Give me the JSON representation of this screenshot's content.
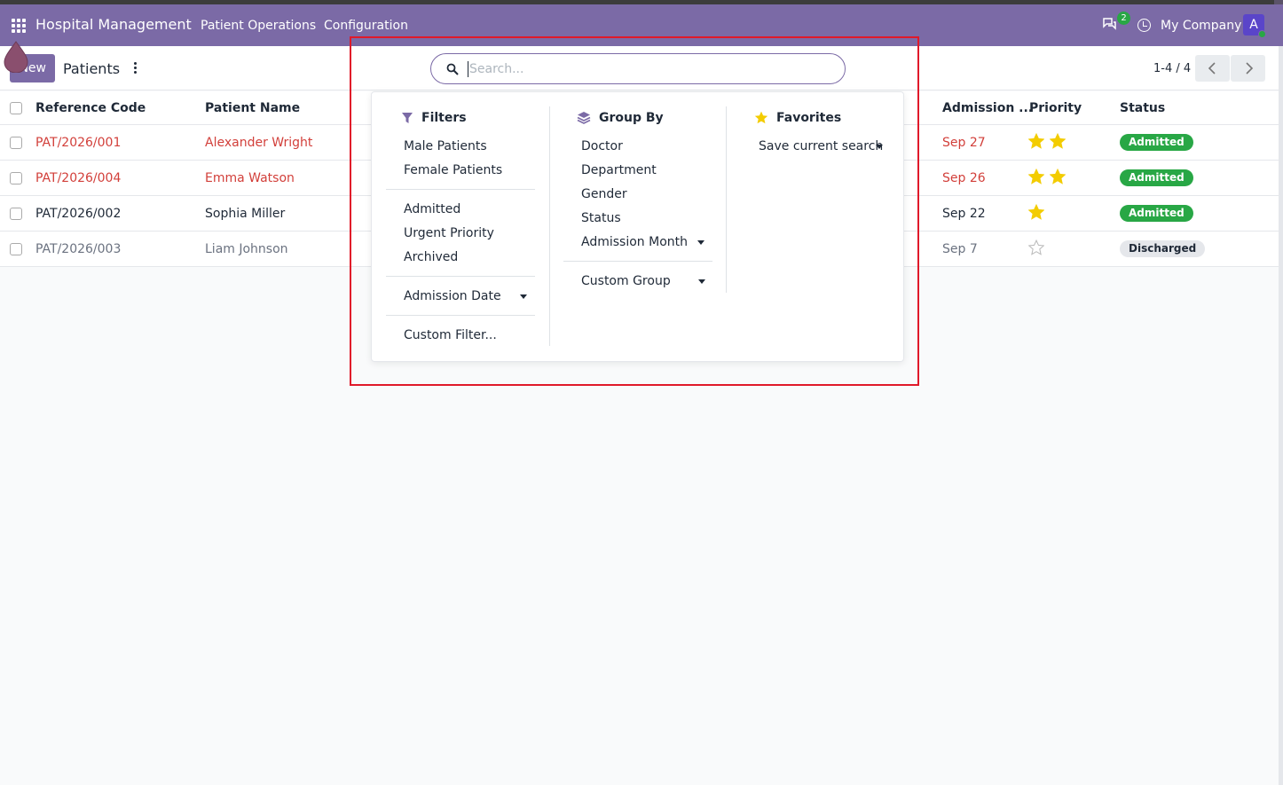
{
  "navbar": {
    "brand": "Hospital Management",
    "menus": [
      "Patient Operations",
      "Configuration"
    ],
    "message_count": "2",
    "company": "My Company",
    "avatar_letter": "A",
    "bg_color": "#7b6aa6"
  },
  "control": {
    "new_label": "New",
    "title": "Patients",
    "pager": "1-4 / 4"
  },
  "search": {
    "placeholder": "Search...",
    "value": ""
  },
  "table": {
    "headers": {
      "reference": "Reference Code",
      "name": "Patient Name",
      "admission": "Admission ...",
      "priority": "Priority",
      "status": "Status"
    },
    "rows": [
      {
        "reference": "PAT/2026/001",
        "name": "Alexander Wright",
        "admission": "Sep 27",
        "priority": 2,
        "status": "Admitted",
        "style": "red"
      },
      {
        "reference": "PAT/2026/004",
        "name": "Emma Watson",
        "admission": "Sep 26",
        "priority": 2,
        "status": "Admitted",
        "style": "red"
      },
      {
        "reference": "PAT/2026/002",
        "name": "Sophia Miller",
        "admission": "Sep 22",
        "priority": 1,
        "status": "Admitted",
        "style": "normal"
      },
      {
        "reference": "PAT/2026/003",
        "name": "Liam Johnson",
        "admission": "Sep 7",
        "priority": 0,
        "status": "Discharged",
        "style": "gray"
      }
    ]
  },
  "panel": {
    "filters": {
      "heading": "Filters",
      "group1": [
        "Male Patients",
        "Female Patients"
      ],
      "group2": [
        "Admitted",
        "Urgent Priority",
        "Archived"
      ],
      "date_filter": "Admission Date",
      "custom": "Custom Filter..."
    },
    "groupby": {
      "heading": "Group By",
      "items": [
        "Doctor",
        "Department",
        "Gender",
        "Status"
      ],
      "month": "Admission Month",
      "custom": "Custom Group"
    },
    "favorites": {
      "heading": "Favorites",
      "save": "Save current search"
    }
  },
  "colors": {
    "accent": "#7b6aa6",
    "admitted": "#28a745",
    "star": "#f3cc00",
    "urgent_text": "#d23f3a",
    "highlight_box": "#e0192a"
  }
}
